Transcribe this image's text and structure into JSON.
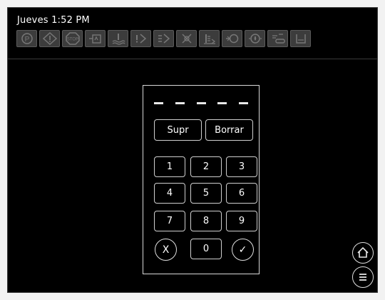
{
  "status": {
    "datetime": "Jueves 1:52 PM"
  },
  "toolbar": {
    "icons": [
      "parking-brake-icon",
      "warning-icon",
      "stop-icon",
      "engine-coolant-icon",
      "coolant-temperature-icon",
      "transmission-warning-icon",
      "transmission-icon",
      "hydraulic-filter-icon",
      "fuel-level-icon",
      "engine-oil-icon",
      "oil-pressure-icon",
      "air-filter-icon",
      "tank-icon"
    ]
  },
  "keypad": {
    "pin_length": 5,
    "delete_label": "Supr",
    "clear_label": "Borrar",
    "digits": [
      "1",
      "2",
      "3",
      "4",
      "5",
      "6",
      "7",
      "8",
      "9"
    ],
    "zero": "0",
    "cancel_label": "X",
    "confirm_label": "✓"
  },
  "colors": {
    "background": "#000000",
    "foreground": "#ffffff",
    "icon_fill": "#3c3c3c",
    "icon_stroke": "#6a6a6a"
  }
}
